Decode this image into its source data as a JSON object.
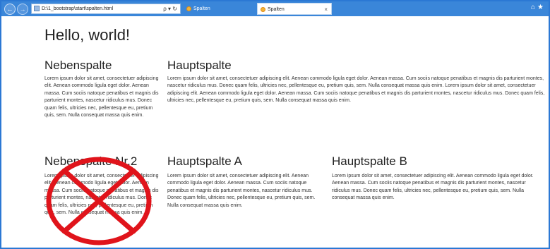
{
  "browser": {
    "address_url": "D:\\1_bootstrap\\start\\spalten.html",
    "address_tools": "ρ ▾ ↻",
    "tabs": [
      {
        "label": "Spalten",
        "active": false
      },
      {
        "label": "Spalten",
        "active": true
      }
    ],
    "close_glyph": "×"
  },
  "page": {
    "heading": "Hello, world!",
    "row1": {
      "side": {
        "title": "Nebenspalte",
        "text": "Lorem ipsum dolor sit amet, consectetuer adipiscing elit. Aenean commodo ligula eget dolor. Aenean massa. Cum sociis natoque penatibus et magnis dis parturient montes, nascetur ridiculus mus. Donec quam felis, ultricies nec, pellentesque eu, pretium quis, sem. Nulla consequat massa quis enim."
      },
      "main": {
        "title": "Hauptspalte",
        "text": "Lorem ipsum dolor sit amet, consectetuer adipiscing elit. Aenean commodo ligula eget dolor. Aenean massa. Cum sociis natoque penatibus et magnis dis parturient montes, nascetur ridiculus mus. Donec quam felis, ultricies nec, pellentesque eu, pretium quis, sem. Nulla consequat massa quis enim. Lorem ipsum dolor sit amet, consectetuer adipiscing elit. Aenean commodo ligula eget dolor. Aenean massa. Cum sociis natoque penatibus et magnis dis parturient montes, nascetur ridiculus mus. Donec quam felis, ultricies nec, pellentesque eu, pretium quis, sem. Nulla consequat massa quis enim."
      }
    },
    "row2": {
      "side": {
        "title": "Nebenspalte Nr.2",
        "text": "Lorem ipsum dolor sit amet, consectetuer adipiscing elit. Aenean commodo ligula eget dolor. Aenean massa. Cum sociis natoque penatibus et magnis dis parturient montes, nascetur ridiculus mus. Donec quam felis, ultricies nec, pellentesque eu, pretium quis, sem. Nulla consequat massa quis enim."
      },
      "main_a": {
        "title": "Hauptspalte A",
        "text": "Lorem ipsum dolor sit amet, consectetuer adipiscing elit. Aenean commodo ligula eget dolor. Aenean massa. Cum sociis natoque penatibus et magnis dis parturient montes, nascetur ridiculus mus. Donec quam felis, ultricies nec, pellentesque eu, pretium quis, sem. Nulla consequat massa quis enim."
      },
      "main_b": {
        "title": "Hauptspalte B",
        "text": "Lorem ipsum dolor sit amet, consectetuer adipiscing elit. Aenean commodo ligula eget dolor. Aenean massa. Cum sociis natoque penatibus et magnis dis parturient montes, nascetur ridiculus mus. Donec quam felis, ultricies nec, pellentesque eu, pretium quis, sem. Nulla consequat massa quis enim."
      }
    }
  },
  "colors": {
    "chrome_blue": "#3a86d9",
    "frame_blue": "#2b78d4",
    "prohibition_red": "#e0141b"
  },
  "icons": {
    "back": "back-arrow-icon",
    "forward": "forward-arrow-icon",
    "page": "page-icon",
    "tab": "ie-tab-icon",
    "home": "home-icon",
    "favorites": "star-icon",
    "overlay": "prohibition-sign-icon"
  }
}
